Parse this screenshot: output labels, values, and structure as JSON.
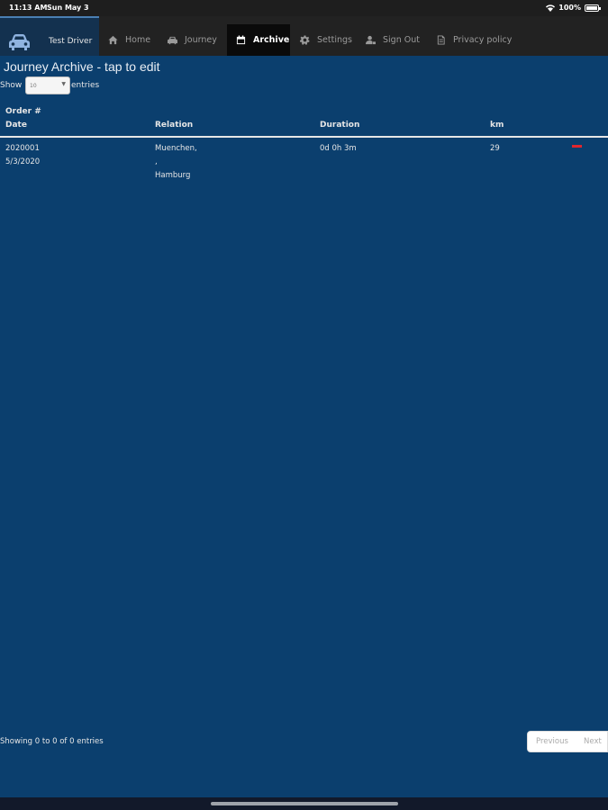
{
  "status_bar": {
    "time": "11:13 AM",
    "date": "Sun May 3",
    "battery": "100%",
    "battery_level": 1.0
  },
  "navbar": {
    "brand_label": "Test Driver",
    "items": [
      {
        "label": "Home",
        "icon": "home-icon"
      },
      {
        "label": "Journey",
        "icon": "car-icon"
      },
      {
        "label": "Archive",
        "icon": "calendar-icon",
        "active": true
      },
      {
        "label": "Settings",
        "icon": "gear-icon"
      },
      {
        "label": "Sign Out",
        "icon": "user-icon"
      },
      {
        "label": "Privacy policy",
        "icon": "document-icon"
      }
    ]
  },
  "page": {
    "title": "Journey Archive - tap to edit",
    "show_label": "Show",
    "entries_value": "10",
    "entries_label": "entries"
  },
  "table": {
    "headers": {
      "order": "Order #",
      "date": "Date",
      "relation": "Relation",
      "duration": "Duration",
      "km": "km"
    },
    "rows": [
      {
        "order": "2020001",
        "date": "5/3/2020",
        "relation_line1": "Muenchen,",
        "relation_line2": ",",
        "relation_line3": "Hamburg",
        "duration": "0d 0h 3m",
        "km": "29"
      }
    ]
  },
  "footer": {
    "info": "Showing 0 to 0 of 0 entries",
    "previous": "Previous",
    "next": "Next"
  },
  "colors": {
    "background": "#0b3f6e",
    "navbar": "#222222",
    "delete": "#e0262d"
  }
}
